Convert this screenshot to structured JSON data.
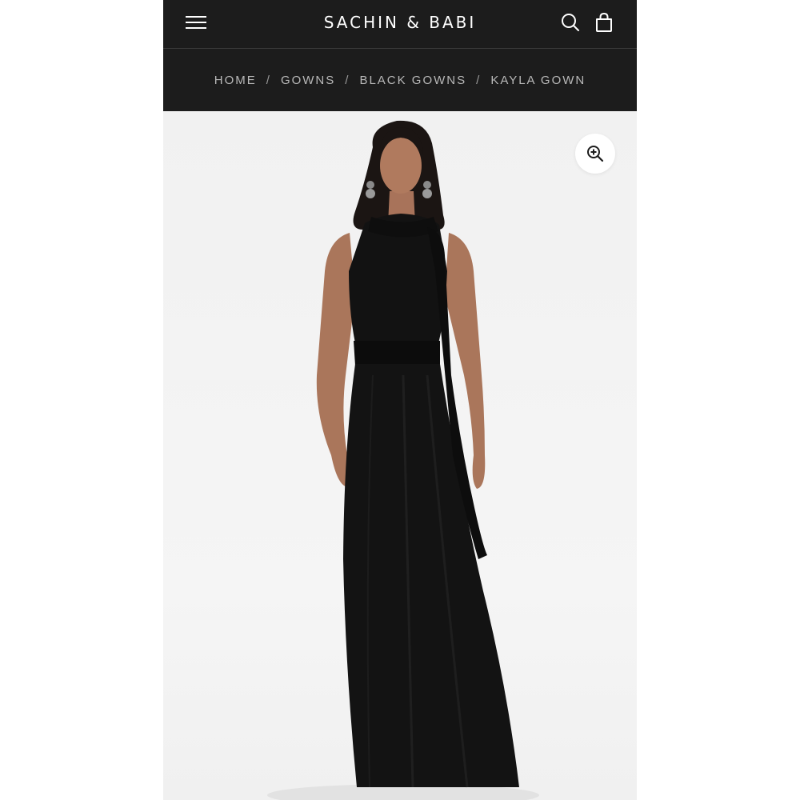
{
  "header": {
    "brand": "SACHIN & BABI",
    "menu_icon": "hamburger-menu-icon",
    "search_icon": "search-icon",
    "cart_icon": "shopping-bag-icon"
  },
  "breadcrumb": {
    "items": [
      "HOME",
      "GOWNS",
      "BLACK GOWNS"
    ],
    "separator": "/",
    "current": "KAYLA GOWN"
  },
  "product_image": {
    "zoom_icon": "zoom-in-icon"
  },
  "colors": {
    "header_bg": "#1c1c1c",
    "header_text": "#ffffff",
    "breadcrumb_text": "#b8b8b8",
    "image_bg": "#f3f3f3",
    "gown": "#111111"
  }
}
